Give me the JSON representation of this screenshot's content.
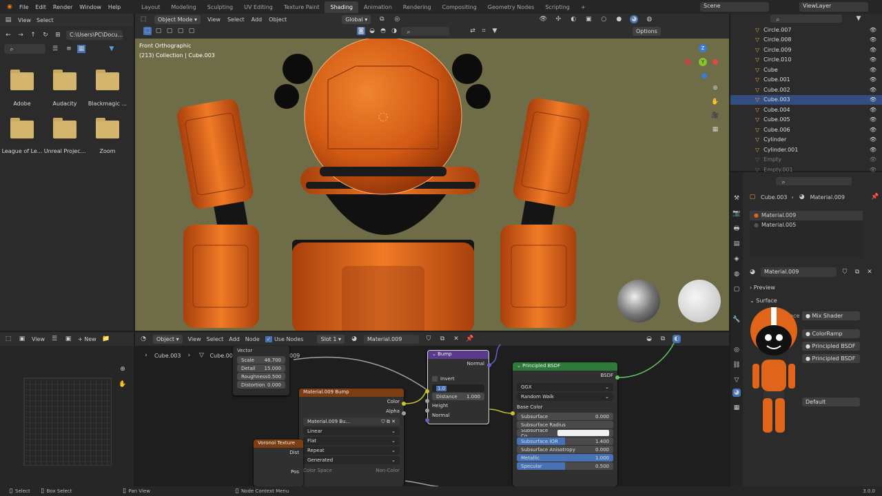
{
  "topbar": {
    "menus": [
      "File",
      "Edit",
      "Render",
      "Window",
      "Help"
    ],
    "workspaces": [
      "Layout",
      "Modeling",
      "Sculpting",
      "UV Editing",
      "Texture Paint",
      "Shading",
      "Animation",
      "Rendering",
      "Compositing",
      "Geometry Nodes",
      "Scripting"
    ],
    "active_workspace": "Shading",
    "scene": "Scene",
    "view_layer": "ViewLayer"
  },
  "filebrowser": {
    "view": "View",
    "select": "Select",
    "path": "C:\\Users\\PC\\Docu...",
    "folders": [
      "Adobe",
      "Audacity",
      "Blackmagic ...",
      "League of Le...",
      "Unreal Projec...",
      "Zoom"
    ]
  },
  "viewport_header": {
    "mode": "Object Mode",
    "view": "View",
    "select": "Select",
    "add": "Add",
    "object": "Object",
    "orientation": "Global",
    "options": "Options"
  },
  "viewport": {
    "view_name": "Front Orthographic",
    "collection_info": "(213) Collection | Cube.003",
    "gizmo": {
      "z": "Z",
      "y": "Y",
      "x": "X"
    }
  },
  "outliner": {
    "items": [
      {
        "name": "Circle.007"
      },
      {
        "name": "Circle.008"
      },
      {
        "name": "Circle.009"
      },
      {
        "name": "Circle.010"
      },
      {
        "name": "Cube"
      },
      {
        "name": "Cube.001"
      },
      {
        "name": "Cube.002"
      },
      {
        "name": "Cube.003",
        "selected": true
      },
      {
        "name": "Cube.004"
      },
      {
        "name": "Cube.005"
      },
      {
        "name": "Cube.006"
      },
      {
        "name": "Cylinder"
      },
      {
        "name": "Cylinder.001"
      },
      {
        "name": "Empty",
        "dim": true
      },
      {
        "name": "Empty.001",
        "dim": true
      }
    ]
  },
  "properties": {
    "breadcrumb_object": "Cube.003",
    "breadcrumb_material": "Material.009",
    "slots": [
      "Material.009",
      "Material.005"
    ],
    "material_name": "Material.009",
    "preview": "Preview",
    "surface": "Surface",
    "surface_label": "Surface",
    "mix_shader": "Mix Shader",
    "color_ramp": "ColorRamp",
    "principled_1": "Principled BSDF",
    "principled_2": "Principled BSDF",
    "default_label": "Default"
  },
  "image_editor": {
    "view": "View",
    "new": "New"
  },
  "node_header": {
    "object": "Object",
    "view": "View",
    "select": "Select",
    "add": "Add",
    "node": "Node",
    "use_nodes": "Use Nodes",
    "slot": "Slot 1",
    "material": "Material.009"
  },
  "node_breadcrumb": {
    "obj": "Cube.003",
    "mesh": "Cube.003",
    "mat": "Material.009"
  },
  "nodes": {
    "noise": {
      "vector": "Vector",
      "rows": [
        {
          "label": "Scale",
          "value": "46.700"
        },
        {
          "label": "Detail",
          "value": "15.000"
        },
        {
          "label": "Roughness",
          "value": "0.500"
        },
        {
          "label": "Distortion",
          "value": "0.000"
        }
      ]
    },
    "bump_image": {
      "title": "Material.009 Bump",
      "color": "Color",
      "alpha": "Alpha",
      "image_name": "Material.009 Bu...",
      "interp": "Linear",
      "projection": "Flat",
      "extension": "Repeat",
      "source": "Generated",
      "color_space": "Color Space",
      "color_space_value": "Non-Color"
    },
    "voronoi": {
      "title": "Voronoi Texture",
      "dist": "Dist",
      "pos": "Pos"
    },
    "bump": {
      "title": "Bump",
      "normal_out": "Normal",
      "invert": "Invert",
      "strength": "1.0",
      "distance_label": "Distance",
      "distance": "1.000",
      "height": "Height",
      "normal_in": "Normal"
    },
    "principled": {
      "title": "Principled BSDF",
      "bsdf": "BSDF",
      "distribution": "GGX",
      "sss_method": "Random Walk",
      "base_color": "Base Color",
      "rows": [
        {
          "label": "Subsurface",
          "value": "0.000",
          "fill": 0
        },
        {
          "label": "Subsurface Radius",
          "value": "",
          "fill": 0
        },
        {
          "label": "Subsurface Co...",
          "value": "",
          "fill": 0
        },
        {
          "label": "Subsurface IOR",
          "value": "1.400",
          "fill": 0.5
        },
        {
          "label": "Subsurface Anisotropy",
          "value": "0.000",
          "fill": 0
        },
        {
          "label": "Metallic",
          "value": "1.000",
          "fill": 1
        },
        {
          "label": "Specular",
          "value": "0.500",
          "fill": 0.5
        }
      ]
    }
  },
  "statusbar": {
    "select": "Select",
    "box_select": "Box Select",
    "pan_view": "Pan View",
    "node_context": "Node Context Menu",
    "version": "3.0.0"
  },
  "colors": {
    "accent": "#4772b3",
    "robot_orange": "#e0641a",
    "viewport_bg": "#6f6d48"
  }
}
